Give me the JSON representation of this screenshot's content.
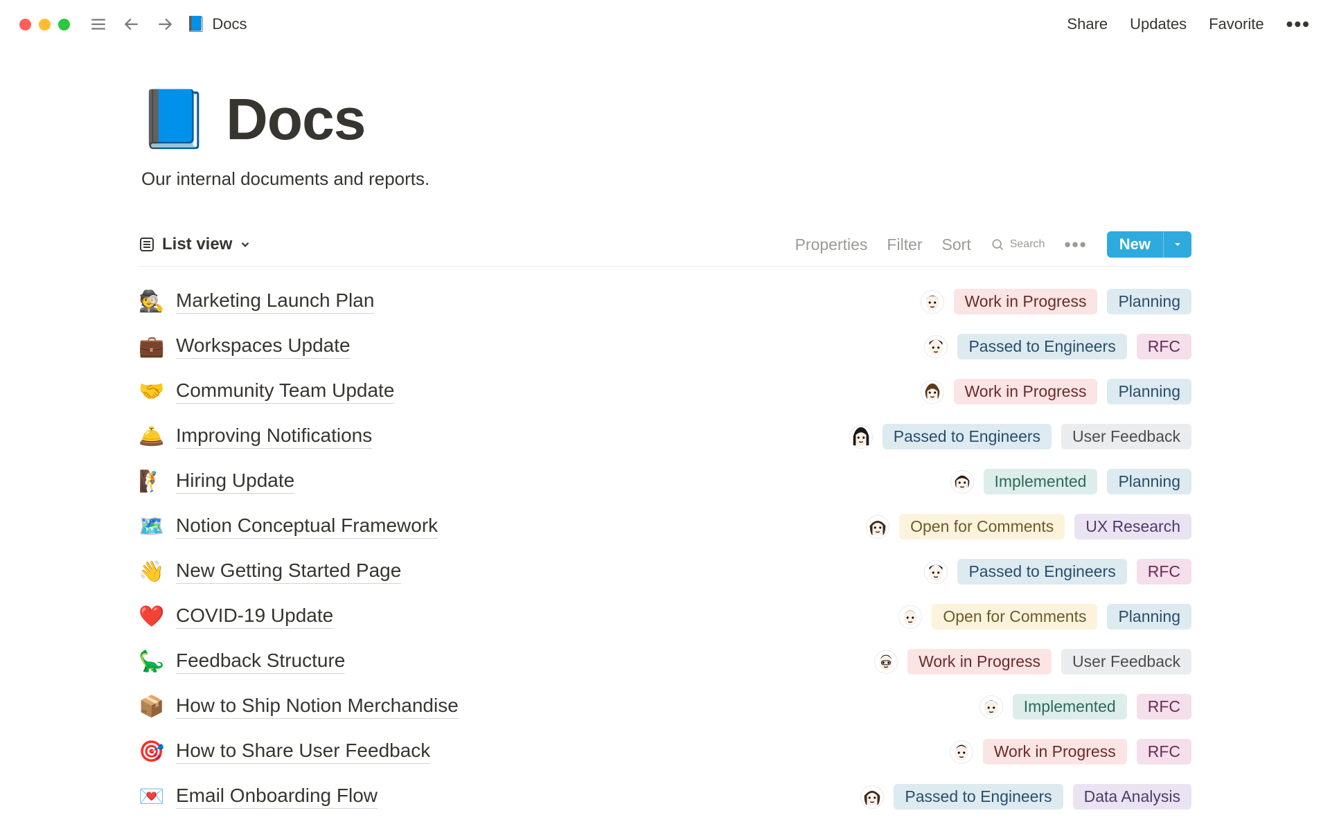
{
  "topbar": {
    "breadcrumb_icon": "📘",
    "breadcrumb_title": "Docs",
    "share": "Share",
    "updates": "Updates",
    "favorite": "Favorite"
  },
  "page": {
    "icon": "📘",
    "title": "Docs",
    "subtitle": "Our internal documents and reports."
  },
  "viewbar": {
    "view_label": "List view",
    "properties": "Properties",
    "filter": "Filter",
    "sort": "Sort",
    "search": "Search",
    "new": "New"
  },
  "tag_colors": {
    "Work in Progress": "red",
    "Planning": "blue",
    "Passed to Engineers": "blue",
    "RFC": "pink",
    "User Feedback": "gray",
    "Implemented": "green",
    "Open for Comments": "yellow",
    "UX Research": "purple",
    "Data Analysis": "purple"
  },
  "rows": [
    {
      "emoji": "🕵️",
      "title": "Marketing Launch Plan",
      "avatar": 0,
      "tags": [
        "Work in Progress",
        "Planning"
      ]
    },
    {
      "emoji": "💼",
      "title": "Workspaces Update",
      "avatar": 1,
      "tags": [
        "Passed to Engineers",
        "RFC"
      ]
    },
    {
      "emoji": "🤝",
      "title": "Community Team Update",
      "avatar": 2,
      "tags": [
        "Work in Progress",
        "Planning"
      ]
    },
    {
      "emoji": "🛎️",
      "title": "Improving Notifications",
      "avatar": 3,
      "tags": [
        "Passed to Engineers",
        "User Feedback"
      ]
    },
    {
      "emoji": "🧗",
      "title": "Hiring Update",
      "avatar": 4,
      "tags": [
        "Implemented",
        "Planning"
      ]
    },
    {
      "emoji": "🗺️",
      "title": "Notion Conceptual Framework",
      "avatar": 5,
      "tags": [
        "Open for Comments",
        "UX Research"
      ]
    },
    {
      "emoji": "👋",
      "title": "New Getting Started Page",
      "avatar": 1,
      "tags": [
        "Passed to Engineers",
        "RFC"
      ]
    },
    {
      "emoji": "❤️",
      "title": "COVID-19 Update",
      "avatar": 6,
      "tags": [
        "Open for Comments",
        "Planning"
      ]
    },
    {
      "emoji": "🦕",
      "title": "Feedback Structure",
      "avatar": 7,
      "tags": [
        "Work in Progress",
        "User Feedback"
      ]
    },
    {
      "emoji": "📦",
      "title": "How to Ship Notion Merchandise",
      "avatar": 8,
      "tags": [
        "Implemented",
        "RFC"
      ]
    },
    {
      "emoji": "🎯",
      "title": "How to Share User Feedback",
      "avatar": 9,
      "tags": [
        "Work in Progress",
        "RFC"
      ]
    },
    {
      "emoji": "💌",
      "title": "Email Onboarding Flow",
      "avatar": 5,
      "tags": [
        "Passed to Engineers",
        "Data Analysis"
      ]
    }
  ]
}
